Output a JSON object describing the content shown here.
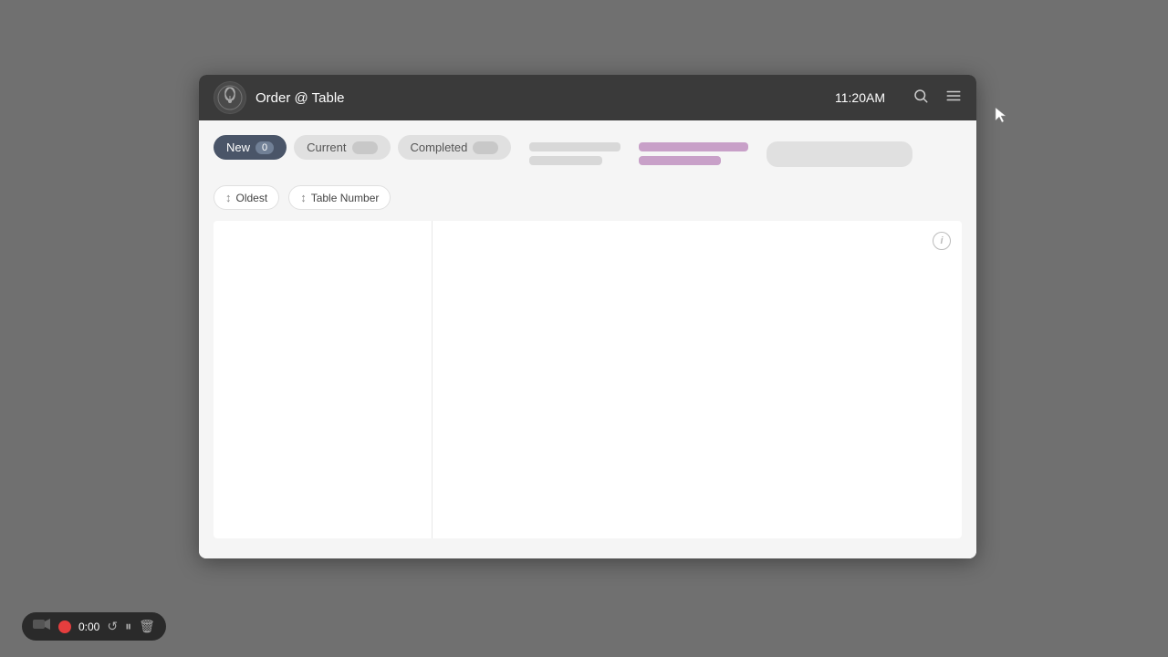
{
  "app": {
    "title": "Order @ Table",
    "time": "11:20 AM"
  },
  "header": {
    "title": "Order @ Table",
    "time": "11:20AM",
    "search_icon": "search",
    "menu_icon": "menu"
  },
  "tabs": [
    {
      "label": "New",
      "badge": "0",
      "active": true
    },
    {
      "label": "Current",
      "badge": "",
      "active": false
    },
    {
      "label": "Completed",
      "badge": "",
      "active": false
    }
  ],
  "filters": [
    {
      "label": "Oldest",
      "icon": "↕"
    },
    {
      "label": "Table Number",
      "icon": "↕"
    }
  ],
  "bottom_bar": {
    "time": "0:00"
  },
  "info_icon_label": "i"
}
